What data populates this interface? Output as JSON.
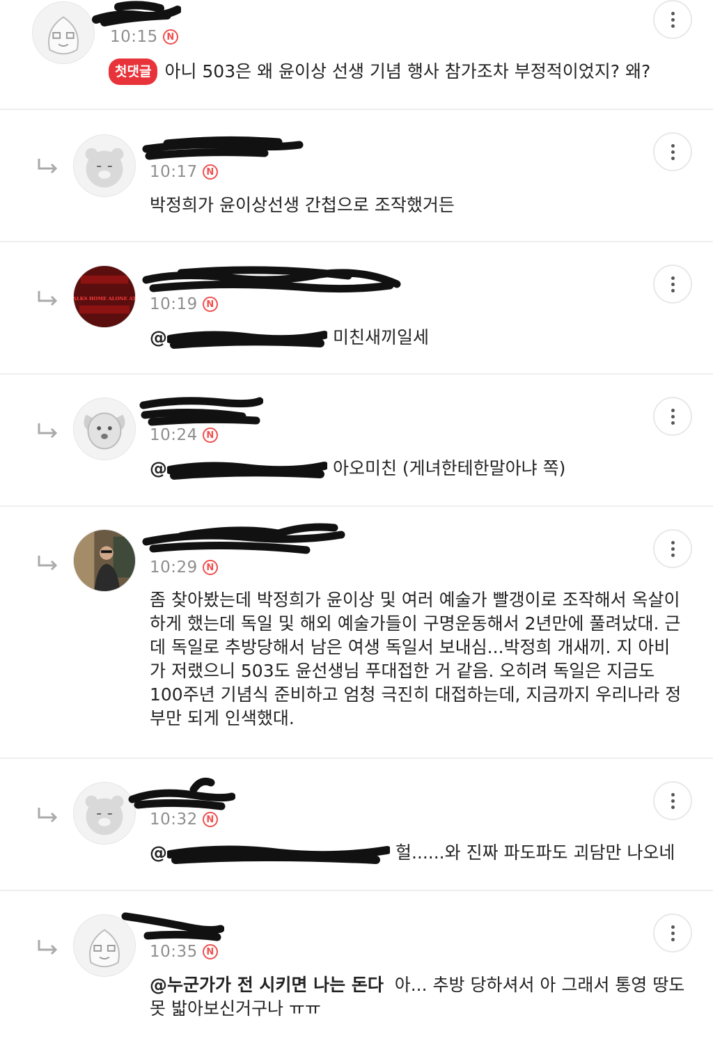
{
  "colors": {
    "badge_red": "#e8333a",
    "n_badge": "#f04e4e",
    "time": "#8e8e8e",
    "divider": "#eeeeee"
  },
  "comments": [
    {
      "time": "10:15",
      "n": "N",
      "badge": "첫댓글",
      "text": "아니 503은 왜 윤이상 선생 기념 행사 참가조차 부정적이었지? 왜?",
      "avatar_icon": "peach-character-icon"
    },
    {
      "time": "10:17",
      "n": "N",
      "text": "박정희가 윤이상선생 간첩으로 조작했거든",
      "avatar_icon": "bear-character-icon"
    },
    {
      "time": "10:19",
      "n": "N",
      "mention_prefix": "@",
      "text": "미친새끼일세",
      "avatar_icon": "poster-avatar-icon",
      "avatar_text": "GIRL WALKS HOME ALONE AT NIGHT"
    },
    {
      "time": "10:24",
      "n": "N",
      "mention_prefix": "@",
      "text": "아오미친 (게녀한테한말아냐 쪽)",
      "avatar_icon": "dog-character-icon"
    },
    {
      "time": "10:29",
      "n": "N",
      "text": "좀 찾아봤는데 박정희가 윤이상 및 여러 예술가 빨갱이로 조작해서 옥살이하게 했는데 독일 및 해외 예술가들이 구명운동해서 2년만에 풀려났대. 근데 독일로 추방당해서 남은 여생 독일서 보내심...박정희 개새끼. 지 아비가 저랬으니 503도 윤선생님 푸대접한 거 같음. 오히려 독일은 지금도 100주년 기념식 준비하고 엄청 극진히 대접하는데, 지금까지 우리나라 정부만 되게 인색했대.",
      "avatar_icon": "photo-avatar-icon"
    },
    {
      "time": "10:32",
      "n": "N",
      "mention_prefix": "@",
      "text": "헐......와 진짜 파도파도 괴담만 나오네",
      "avatar_icon": "bear-character-icon"
    },
    {
      "time": "10:35",
      "n": "N",
      "mention": "@누군가가 전 시키면 나는 돈다",
      "text": "아... 추방 당하셔서 아 그래서 통영 땅도 못 밟아보신거구나 ㅠㅠ",
      "avatar_icon": "peach-character-icon"
    }
  ]
}
